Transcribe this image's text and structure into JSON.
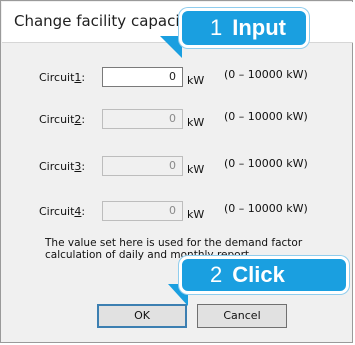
{
  "window": {
    "title": "Change facility capacity"
  },
  "callouts": [
    {
      "number": "1",
      "word": "Input"
    },
    {
      "number": "2",
      "word": "Click"
    }
  ],
  "unit": "kW",
  "circuits": [
    {
      "label": "Circuit",
      "num": "1",
      "colon": ":",
      "value": "0",
      "range": "(0 – 10000 kW)"
    },
    {
      "label": "Circuit",
      "num": "2",
      "colon": ":",
      "value": "0",
      "range": "(0 – 10000 kW)"
    },
    {
      "label": "Circuit",
      "num": "3",
      "colon": ":",
      "value": "0",
      "range": "(0 – 10000 kW)"
    },
    {
      "label": "Circuit",
      "num": "4",
      "colon": ":",
      "value": "0",
      "range": "(0 – 10000 kW)"
    }
  ],
  "note": "The value set here is used for the demand factor calculation of daily and monthly report.",
  "buttons": {
    "ok": "OK",
    "cancel": "Cancel"
  }
}
